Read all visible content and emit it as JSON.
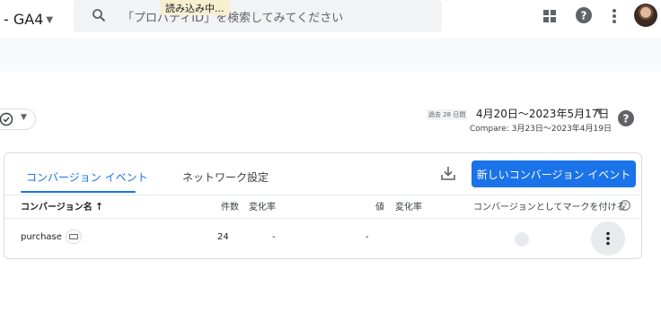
{
  "header": {
    "property_name": "- GA4",
    "search_placeholder": "「プロパティID」を検索してみてください",
    "loading_text": "読み込み中..."
  },
  "filter": {
    "icon": "check-circle-icon"
  },
  "date_range": {
    "badge": "過去 28 日間",
    "range": "4月20日～2023年5月17日",
    "compare": "Compare: 3月23日～2023年4月19日"
  },
  "tabs": [
    {
      "label": "コンバージョン イベント",
      "active": true
    },
    {
      "label": "ネットワーク設定",
      "active": false
    }
  ],
  "actions": {
    "new_event_label": "新しいコンバージョン イベント"
  },
  "table": {
    "columns": {
      "name": "コンバージョン名",
      "sort_arrow": "↑",
      "count": "件数",
      "count_change": "変化率",
      "value": "値",
      "value_change": "変化率",
      "mark_as_conversion": "コンバージョンとしてマークを付ける"
    },
    "rows": [
      {
        "name": "purchase",
        "count": "24",
        "count_change": "-",
        "value": "-",
        "value_change": "",
        "marked": true
      }
    ]
  },
  "colors": {
    "accent": "#1a73e8",
    "text": "#202124",
    "muted": "#5f6368",
    "border": "#dadce0"
  }
}
